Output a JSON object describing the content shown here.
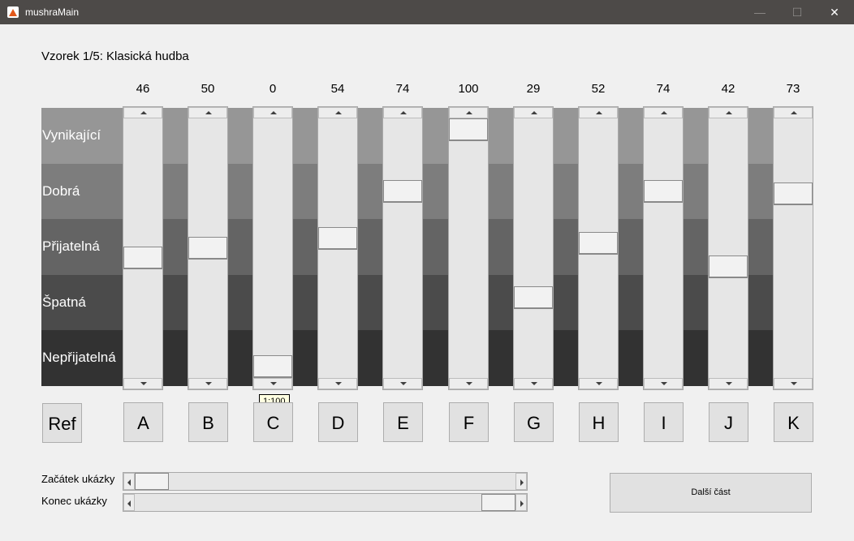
{
  "window": {
    "title": "mushraMain",
    "icon": "matlab-icon",
    "minimize_glyph": "—",
    "maximize_glyph": "☐",
    "close_glyph": "✕"
  },
  "sample_title": "Vzorek 1/5: Klasická hudba",
  "rating_scale": [
    {
      "label": "Vynikající",
      "color": "#969696"
    },
    {
      "label": "Dobrá",
      "color": "#7d7d7d"
    },
    {
      "label": "Přijatelná",
      "color": "#646464"
    },
    {
      "label": "Špatná",
      "color": "#4b4b4b"
    },
    {
      "label": "Nepřijatelná",
      "color": "#323232"
    }
  ],
  "sliders": [
    {
      "name": "A",
      "value": 46
    },
    {
      "name": "B",
      "value": 50
    },
    {
      "name": "C",
      "value": 0
    },
    {
      "name": "D",
      "value": 54
    },
    {
      "name": "E",
      "value": 74
    },
    {
      "name": "F",
      "value": 100
    },
    {
      "name": "G",
      "value": 29
    },
    {
      "name": "H",
      "value": 52
    },
    {
      "name": "I",
      "value": 74
    },
    {
      "name": "J",
      "value": 42
    },
    {
      "name": "K",
      "value": 73
    }
  ],
  "slider_range": [
    0,
    100
  ],
  "tooltip": "1:100",
  "ref_button": "Ref",
  "playback": {
    "start_label": "Začátek ukázky",
    "end_label": "Konec ukázky",
    "start_fraction": 0.0,
    "end_fraction": 1.0
  },
  "next_button": "Další část"
}
